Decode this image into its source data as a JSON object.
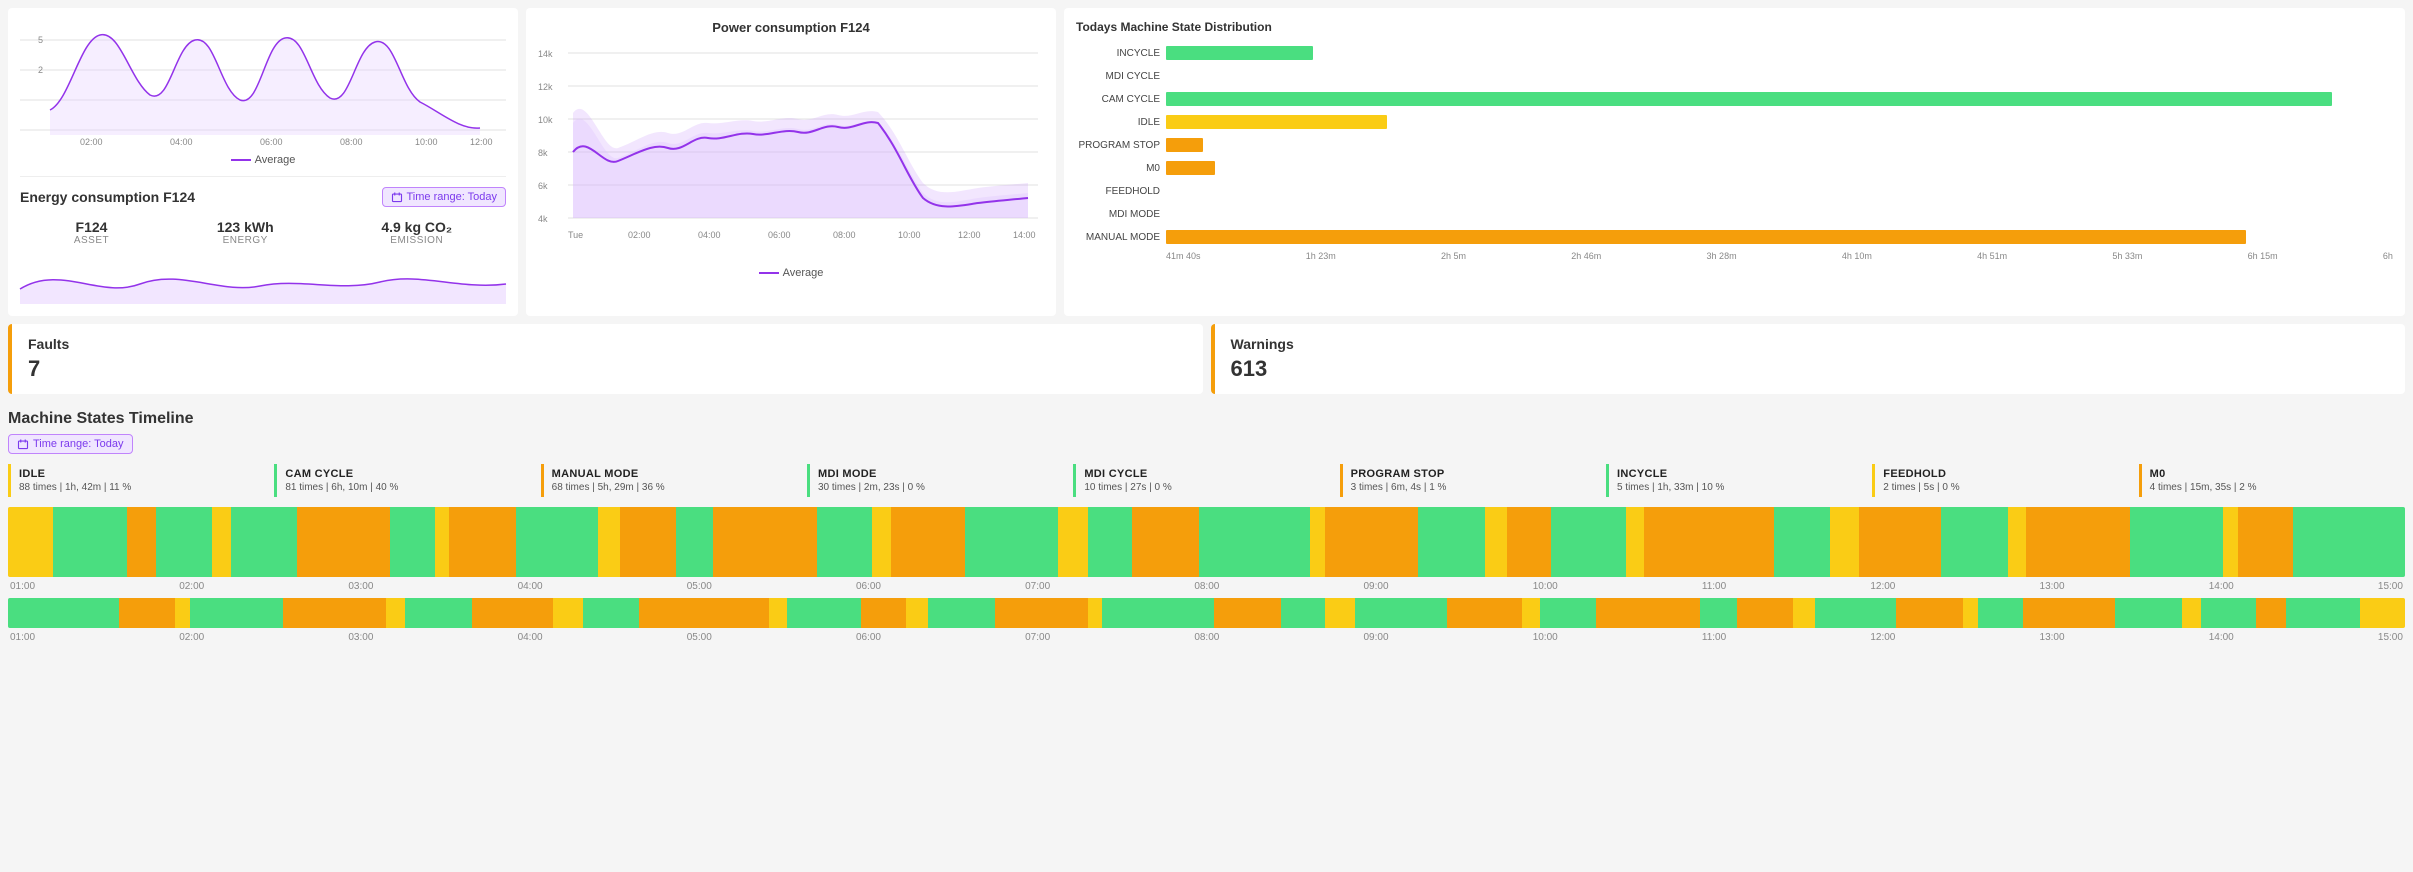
{
  "header": {
    "energy_chart_title": "Energy consumption F124",
    "time_range_label": "Time range: Today",
    "asset_label": "ASSET",
    "asset_value": "F124",
    "energy_label": "ENERGY",
    "energy_value": "123 kWh",
    "emission_label": "EMISSION",
    "emission_value": "4.9 kg CO₂",
    "legend_average": "Average"
  },
  "power_chart": {
    "title": "Power consumption F124",
    "legend": "Average",
    "y_labels": [
      "14k",
      "12k",
      "10k",
      "8k",
      "6k",
      "4k"
    ],
    "x_labels": [
      "Tue",
      "02:00",
      "04:00",
      "06:00",
      "08:00",
      "10:00",
      "12:00",
      "14:00"
    ]
  },
  "state_distribution": {
    "title": "Todays Machine State Distribution",
    "states": [
      {
        "label": "INCYCLE",
        "color": "#4ade80",
        "width_pct": 12
      },
      {
        "label": "MDI CYCLE",
        "color": "#4ade80",
        "width_pct": 0
      },
      {
        "label": "CAM CYCLE",
        "color": "#4ade80",
        "width_pct": 95
      },
      {
        "label": "IDLE",
        "color": "#facc15",
        "width_pct": 18
      },
      {
        "label": "PROGRAM STOP",
        "color": "#f59e0b",
        "width_pct": 3
      },
      {
        "label": "M0",
        "color": "#f59e0b",
        "width_pct": 4
      },
      {
        "label": "FEEDHOLD",
        "color": "#f59e0b",
        "width_pct": 0
      },
      {
        "label": "MDI MODE",
        "color": "#f59e0b",
        "width_pct": 0
      },
      {
        "label": "MANUAL MODE",
        "color": "#f59e0b",
        "width_pct": 88
      }
    ],
    "x_axis": [
      "41m 40s",
      "1h 23m",
      "2h 5m",
      "2h 46m",
      "3h 28m",
      "4h 10m",
      "4h 51m",
      "5h 33m",
      "6h 15m",
      "6h"
    ]
  },
  "faults": {
    "title": "Faults",
    "count": "7",
    "warnings_title": "Warnings",
    "warnings_count": "613"
  },
  "timeline": {
    "title": "Machine States Timeline",
    "time_range_label": "Time range: Today",
    "states": [
      {
        "name": "IDLE",
        "color": "#facc15",
        "stats": "88 times | 1h, 42m | 11 %"
      },
      {
        "name": "CAM CYCLE",
        "color": "#4ade80",
        "stats": "81 times | 6h, 10m | 40 %"
      },
      {
        "name": "MANUAL MODE",
        "color": "#f59e0b",
        "stats": "68 times | 5h, 29m | 36 %"
      },
      {
        "name": "MDI MODE",
        "color": "#4ade80",
        "stats": "30 times | 2m, 23s | 0 %"
      },
      {
        "name": "MDI CYCLE",
        "color": "#4ade80",
        "stats": "10 times | 27s | 0 %"
      },
      {
        "name": "PROGRAM STOP",
        "color": "#f59e0b",
        "stats": "3 times | 6m, 4s | 1 %"
      },
      {
        "name": "INCYCLE",
        "color": "#4ade80",
        "stats": "5 times | 1h, 33m | 10 %"
      },
      {
        "name": "FEEDHOLD",
        "color": "#facc15",
        "stats": "2 times | 5s | 0 %"
      },
      {
        "name": "M0",
        "color": "#f59e0b",
        "stats": "4 times | 15m, 35s | 2 %"
      }
    ],
    "x_axis_labels": [
      "01:00",
      "02:00",
      "03:00",
      "04:00",
      "05:00",
      "06:00",
      "07:00",
      "08:00",
      "09:00",
      "10:00",
      "11:00",
      "12:00",
      "13:00",
      "14:00",
      "15:00"
    ]
  }
}
